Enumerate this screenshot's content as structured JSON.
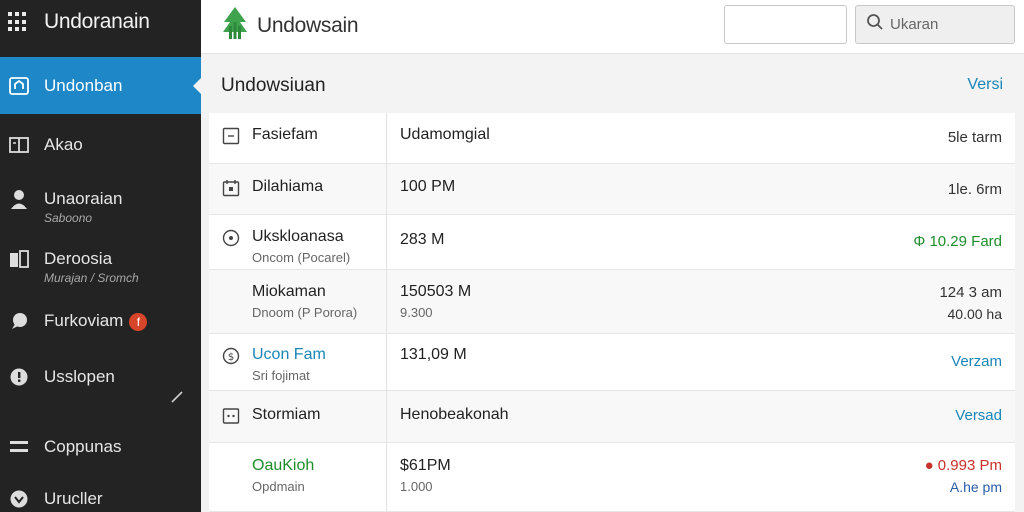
{
  "sidebar": {
    "title": "Undoranain",
    "items": [
      {
        "label": "Undonban",
        "sub": "",
        "icon": "home-icon",
        "active": true
      },
      {
        "label": "Akao",
        "sub": "",
        "icon": "card-icon"
      },
      {
        "label": "Unaoraian",
        "sub": "Saboono",
        "icon": "user-icon"
      },
      {
        "label": "Deroosia",
        "sub": "Murajan / Sromch",
        "icon": "folder-icon"
      },
      {
        "label": "Furkoviam",
        "sub": "",
        "icon": "chat-icon",
        "badge": "f"
      },
      {
        "label": "Usslopen",
        "sub": "",
        "icon": "info-icon"
      },
      {
        "label": "Coppunas",
        "sub": "",
        "icon": "stack-icon"
      },
      {
        "label": "Urucller",
        "sub": "",
        "icon": "chevron-down-icon"
      }
    ]
  },
  "topbar": {
    "app_title": "Undowsain",
    "search_placeholder": "Ukaran"
  },
  "main": {
    "title": "Undowsiuan",
    "link": "Versi",
    "rows": [
      {
        "name": "Fasiefam",
        "name_sub": "",
        "value": "Udamomgial",
        "value_sub": "",
        "right": "5le  tarm",
        "right_sub": "",
        "icon": "square-icon"
      },
      {
        "name": "Dilahiama",
        "name_sub": "",
        "value": "100 PM",
        "value_sub": "",
        "right": "1le. 6rm",
        "right_sub": "",
        "icon": "calendar-icon"
      },
      {
        "name": "Ukskloanasa",
        "name_sub": "Oncom (Pocarel)",
        "value": "283 M",
        "value_sub": "",
        "right": "Φ 10.29 Fard",
        "right_sub": "",
        "icon": "clock-icon",
        "right_color": "green"
      },
      {
        "name": "Miokaman",
        "name_sub": "Dnoom (P Porora)",
        "value": "150503 M",
        "value_sub": "9.300",
        "right": "124 3 am",
        "right_sub": "40.00 ha",
        "icon": ""
      },
      {
        "name": "Ucon Fam",
        "name_sub": "Sri fojimat",
        "value": "131,09 M",
        "value_sub": "",
        "right": "Verzam",
        "right_sub": "",
        "icon": "dollar-icon",
        "name_color": "blue",
        "right_color": "blue"
      },
      {
        "name": "Stormiam",
        "name_sub": "",
        "value": "Henobeakonah",
        "value_sub": "",
        "right": "Versad",
        "right_sub": "",
        "icon": "dots-icon",
        "right_color": "blue"
      },
      {
        "name": "OauKioh",
        "name_sub": "Opdmain",
        "value": "$61PM",
        "value_sub": "1.000",
        "right": "● 0.993 Pm",
        "right_sub": "A.he pm",
        "icon": "",
        "name_color": "green",
        "right_color": "red",
        "right_sub_color": "dblue"
      }
    ]
  },
  "colors": {
    "sidebar_bg": "#232323",
    "active": "#1e87c8",
    "link": "#1a86b8",
    "positive": "#1f8e2b",
    "negative": "#c9302c"
  }
}
